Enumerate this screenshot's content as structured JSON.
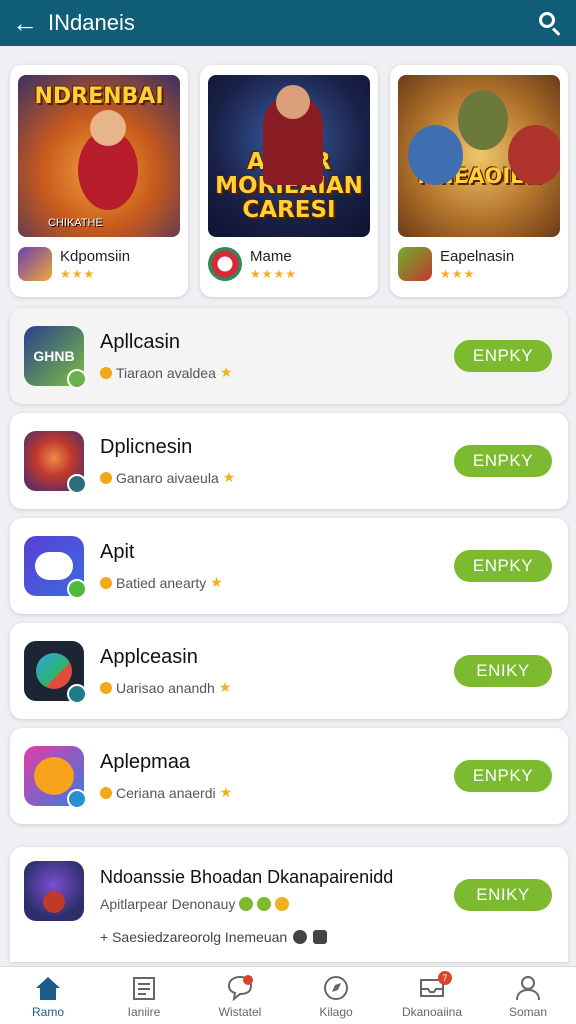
{
  "appbar": {
    "title": "INdaneis",
    "back_icon": "arrow-left-icon",
    "search_icon": "search-icon"
  },
  "featured": [
    {
      "banner_text": "NDRENBAI",
      "banner_sub": "CHIKATHE",
      "name": "Kdpomsiin",
      "stars": "★★★"
    },
    {
      "banner_text": "AJPMR MORIEAIAN CARESI",
      "banner_sub": "",
      "name": "Mame",
      "stars": "★★★★"
    },
    {
      "banner_text": "MIIEAOIER",
      "banner_sub": "",
      "name": "Eapelnasin",
      "stars": "★★★"
    }
  ],
  "apps": [
    {
      "name": "Apllcasin",
      "subtitle": "Tiaraon avaldea",
      "button": "ENPKY"
    },
    {
      "name": "Dplicnesin",
      "subtitle": "Ganaro aivaeula",
      "button": "ENPKY"
    },
    {
      "name": "Apit",
      "subtitle": "Batied anearty",
      "button": "ENPKY"
    },
    {
      "name": "Applceasin",
      "subtitle": "Uarisao anandh",
      "button": "ENIKY"
    },
    {
      "name": "Aplepmaa",
      "subtitle": "Ceriana anaerdi",
      "button": "ENPKY"
    }
  ],
  "big_app": {
    "name": "Ndoanssie Bhoadan Dkanapairenidd",
    "subtitle": "Apitlarpear Denonauy",
    "meta": "+ Saesiedzareorolg Inemeuan",
    "button": "ENIKY"
  },
  "nav": [
    {
      "label": "Ramo",
      "icon": "home-icon",
      "badge": ""
    },
    {
      "label": "Ianiire",
      "icon": "document-icon",
      "badge": ""
    },
    {
      "label": "Wistatel",
      "icon": "chat-icon",
      "badge": ""
    },
    {
      "label": "Kilago",
      "icon": "compass-icon",
      "badge": ""
    },
    {
      "label": "Dkanoaiina",
      "icon": "inbox-icon",
      "badge": "7"
    },
    {
      "label": "Soman",
      "icon": "profile-icon",
      "badge": ""
    }
  ],
  "colors": {
    "appbar": "#0f5d77",
    "button": "#7cbb2f",
    "star": "#f2b01e",
    "active_nav": "#1a5c8c"
  }
}
